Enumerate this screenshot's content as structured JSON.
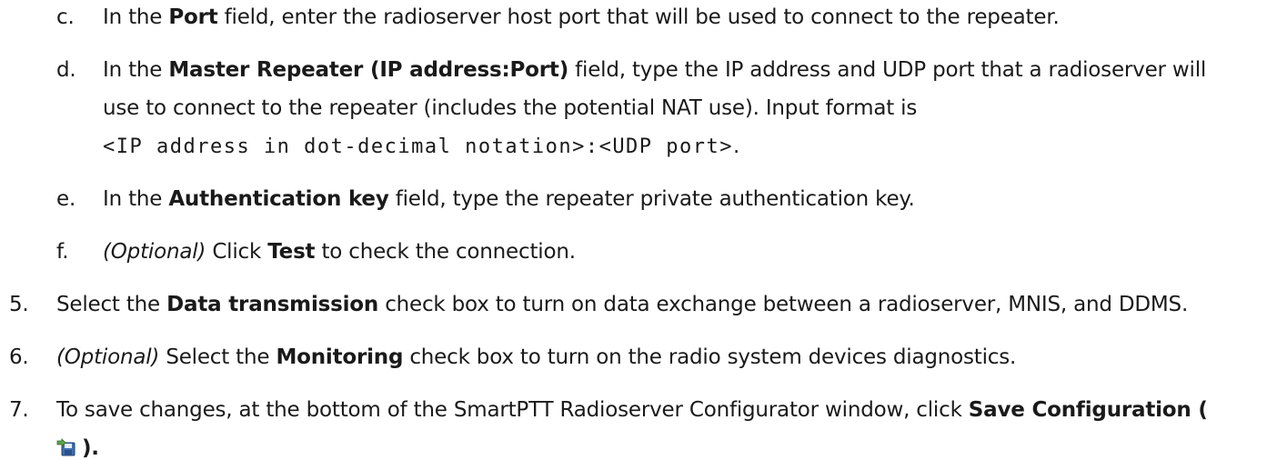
{
  "steps": {
    "c": {
      "marker": "c.",
      "t1": "In the ",
      "b1": "Port",
      "t2": " field, enter the radioserver host port that will be used to connect to the repeater."
    },
    "d": {
      "marker": "d.",
      "t1": "In the ",
      "b1": "Master Repeater (IP address:Port)",
      "t2": " field, type the IP address and UDP port that a radioserver will",
      "line2": "use to connect to the repeater (includes the potential NAT use). Input format is",
      "code": "<IP address in dot-decimal notation>:<UDP port>",
      "code_end": "."
    },
    "e": {
      "marker": "e.",
      "t1": "In the ",
      "b1": "Authentication key",
      "t2": " field, type the repeater private authentication key."
    },
    "f": {
      "marker": "f.",
      "i1": "(Optional)",
      "t1": " Click ",
      "b1": "Test",
      "t2": " to check the connection."
    },
    "s5": {
      "marker": "5.",
      "t1": "Select the ",
      "b1": "Data transmission",
      "t2": " check box to turn on data exchange between a radioserver, MNIS, and DDMS."
    },
    "s6": {
      "marker": "6.",
      "i1": "(Optional)",
      "t1": " Select the ",
      "b1": "Monitoring",
      "t2": " check box to turn on the radio system devices diagnostics."
    },
    "s7": {
      "marker": "7.",
      "t1": "To save changes, at the bottom of the SmartPTT Radioserver Configurator window, click ",
      "b1": "Save Configuration (",
      "end": ")."
    }
  },
  "icons": {
    "save": "save-configuration-icon"
  }
}
